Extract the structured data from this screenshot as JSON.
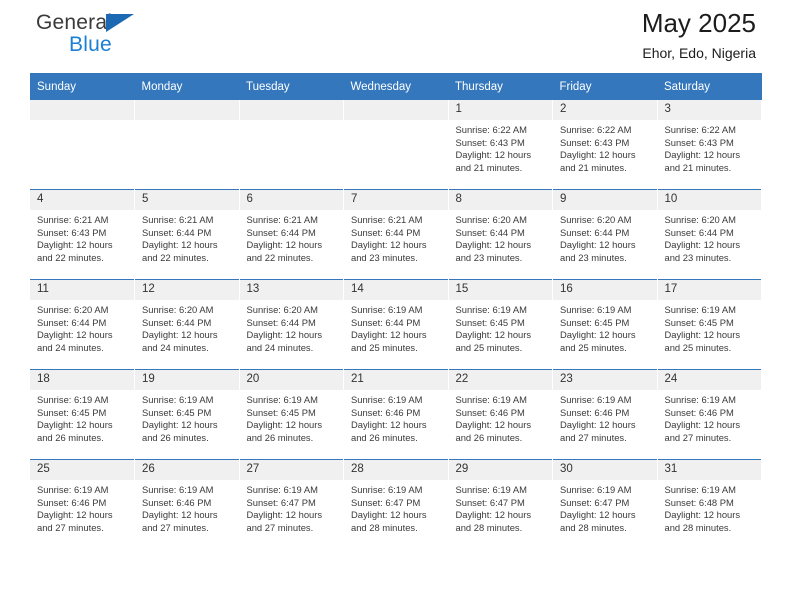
{
  "brand": {
    "line1": "General",
    "line2": "Blue",
    "triangle_color": "#1b69b2",
    "blue_text_color": "#1b7fd4"
  },
  "header": {
    "title": "May 2025",
    "subtitle": "Ehor, Edo, Nigeria"
  },
  "theme": {
    "header_blue": "#3477bd",
    "daynum_background": "#f0f0f0"
  },
  "weekday_headers": [
    "Sunday",
    "Monday",
    "Tuesday",
    "Wednesday",
    "Thursday",
    "Friday",
    "Saturday"
  ],
  "weeks": [
    [
      {
        "day": "",
        "empty": true
      },
      {
        "day": "",
        "empty": true
      },
      {
        "day": "",
        "empty": true
      },
      {
        "day": "",
        "empty": true
      },
      {
        "day": "1",
        "sunrise": "Sunrise: 6:22 AM",
        "sunset": "Sunset: 6:43 PM",
        "daylight1": "Daylight: 12 hours",
        "daylight2": "and 21 minutes."
      },
      {
        "day": "2",
        "sunrise": "Sunrise: 6:22 AM",
        "sunset": "Sunset: 6:43 PM",
        "daylight1": "Daylight: 12 hours",
        "daylight2": "and 21 minutes."
      },
      {
        "day": "3",
        "sunrise": "Sunrise: 6:22 AM",
        "sunset": "Sunset: 6:43 PM",
        "daylight1": "Daylight: 12 hours",
        "daylight2": "and 21 minutes."
      }
    ],
    [
      {
        "day": "4",
        "sunrise": "Sunrise: 6:21 AM",
        "sunset": "Sunset: 6:43 PM",
        "daylight1": "Daylight: 12 hours",
        "daylight2": "and 22 minutes."
      },
      {
        "day": "5",
        "sunrise": "Sunrise: 6:21 AM",
        "sunset": "Sunset: 6:44 PM",
        "daylight1": "Daylight: 12 hours",
        "daylight2": "and 22 minutes."
      },
      {
        "day": "6",
        "sunrise": "Sunrise: 6:21 AM",
        "sunset": "Sunset: 6:44 PM",
        "daylight1": "Daylight: 12 hours",
        "daylight2": "and 22 minutes."
      },
      {
        "day": "7",
        "sunrise": "Sunrise: 6:21 AM",
        "sunset": "Sunset: 6:44 PM",
        "daylight1": "Daylight: 12 hours",
        "daylight2": "and 23 minutes."
      },
      {
        "day": "8",
        "sunrise": "Sunrise: 6:20 AM",
        "sunset": "Sunset: 6:44 PM",
        "daylight1": "Daylight: 12 hours",
        "daylight2": "and 23 minutes."
      },
      {
        "day": "9",
        "sunrise": "Sunrise: 6:20 AM",
        "sunset": "Sunset: 6:44 PM",
        "daylight1": "Daylight: 12 hours",
        "daylight2": "and 23 minutes."
      },
      {
        "day": "10",
        "sunrise": "Sunrise: 6:20 AM",
        "sunset": "Sunset: 6:44 PM",
        "daylight1": "Daylight: 12 hours",
        "daylight2": "and 23 minutes."
      }
    ],
    [
      {
        "day": "11",
        "sunrise": "Sunrise: 6:20 AM",
        "sunset": "Sunset: 6:44 PM",
        "daylight1": "Daylight: 12 hours",
        "daylight2": "and 24 minutes."
      },
      {
        "day": "12",
        "sunrise": "Sunrise: 6:20 AM",
        "sunset": "Sunset: 6:44 PM",
        "daylight1": "Daylight: 12 hours",
        "daylight2": "and 24 minutes."
      },
      {
        "day": "13",
        "sunrise": "Sunrise: 6:20 AM",
        "sunset": "Sunset: 6:44 PM",
        "daylight1": "Daylight: 12 hours",
        "daylight2": "and 24 minutes."
      },
      {
        "day": "14",
        "sunrise": "Sunrise: 6:19 AM",
        "sunset": "Sunset: 6:44 PM",
        "daylight1": "Daylight: 12 hours",
        "daylight2": "and 25 minutes."
      },
      {
        "day": "15",
        "sunrise": "Sunrise: 6:19 AM",
        "sunset": "Sunset: 6:45 PM",
        "daylight1": "Daylight: 12 hours",
        "daylight2": "and 25 minutes."
      },
      {
        "day": "16",
        "sunrise": "Sunrise: 6:19 AM",
        "sunset": "Sunset: 6:45 PM",
        "daylight1": "Daylight: 12 hours",
        "daylight2": "and 25 minutes."
      },
      {
        "day": "17",
        "sunrise": "Sunrise: 6:19 AM",
        "sunset": "Sunset: 6:45 PM",
        "daylight1": "Daylight: 12 hours",
        "daylight2": "and 25 minutes."
      }
    ],
    [
      {
        "day": "18",
        "sunrise": "Sunrise: 6:19 AM",
        "sunset": "Sunset: 6:45 PM",
        "daylight1": "Daylight: 12 hours",
        "daylight2": "and 26 minutes."
      },
      {
        "day": "19",
        "sunrise": "Sunrise: 6:19 AM",
        "sunset": "Sunset: 6:45 PM",
        "daylight1": "Daylight: 12 hours",
        "daylight2": "and 26 minutes."
      },
      {
        "day": "20",
        "sunrise": "Sunrise: 6:19 AM",
        "sunset": "Sunset: 6:45 PM",
        "daylight1": "Daylight: 12 hours",
        "daylight2": "and 26 minutes."
      },
      {
        "day": "21",
        "sunrise": "Sunrise: 6:19 AM",
        "sunset": "Sunset: 6:46 PM",
        "daylight1": "Daylight: 12 hours",
        "daylight2": "and 26 minutes."
      },
      {
        "day": "22",
        "sunrise": "Sunrise: 6:19 AM",
        "sunset": "Sunset: 6:46 PM",
        "daylight1": "Daylight: 12 hours",
        "daylight2": "and 26 minutes."
      },
      {
        "day": "23",
        "sunrise": "Sunrise: 6:19 AM",
        "sunset": "Sunset: 6:46 PM",
        "daylight1": "Daylight: 12 hours",
        "daylight2": "and 27 minutes."
      },
      {
        "day": "24",
        "sunrise": "Sunrise: 6:19 AM",
        "sunset": "Sunset: 6:46 PM",
        "daylight1": "Daylight: 12 hours",
        "daylight2": "and 27 minutes."
      }
    ],
    [
      {
        "day": "25",
        "sunrise": "Sunrise: 6:19 AM",
        "sunset": "Sunset: 6:46 PM",
        "daylight1": "Daylight: 12 hours",
        "daylight2": "and 27 minutes."
      },
      {
        "day": "26",
        "sunrise": "Sunrise: 6:19 AM",
        "sunset": "Sunset: 6:46 PM",
        "daylight1": "Daylight: 12 hours",
        "daylight2": "and 27 minutes."
      },
      {
        "day": "27",
        "sunrise": "Sunrise: 6:19 AM",
        "sunset": "Sunset: 6:47 PM",
        "daylight1": "Daylight: 12 hours",
        "daylight2": "and 27 minutes."
      },
      {
        "day": "28",
        "sunrise": "Sunrise: 6:19 AM",
        "sunset": "Sunset: 6:47 PM",
        "daylight1": "Daylight: 12 hours",
        "daylight2": "and 28 minutes."
      },
      {
        "day": "29",
        "sunrise": "Sunrise: 6:19 AM",
        "sunset": "Sunset: 6:47 PM",
        "daylight1": "Daylight: 12 hours",
        "daylight2": "and 28 minutes."
      },
      {
        "day": "30",
        "sunrise": "Sunrise: 6:19 AM",
        "sunset": "Sunset: 6:47 PM",
        "daylight1": "Daylight: 12 hours",
        "daylight2": "and 28 minutes."
      },
      {
        "day": "31",
        "sunrise": "Sunrise: 6:19 AM",
        "sunset": "Sunset: 6:48 PM",
        "daylight1": "Daylight: 12 hours",
        "daylight2": "and 28 minutes."
      }
    ]
  ]
}
